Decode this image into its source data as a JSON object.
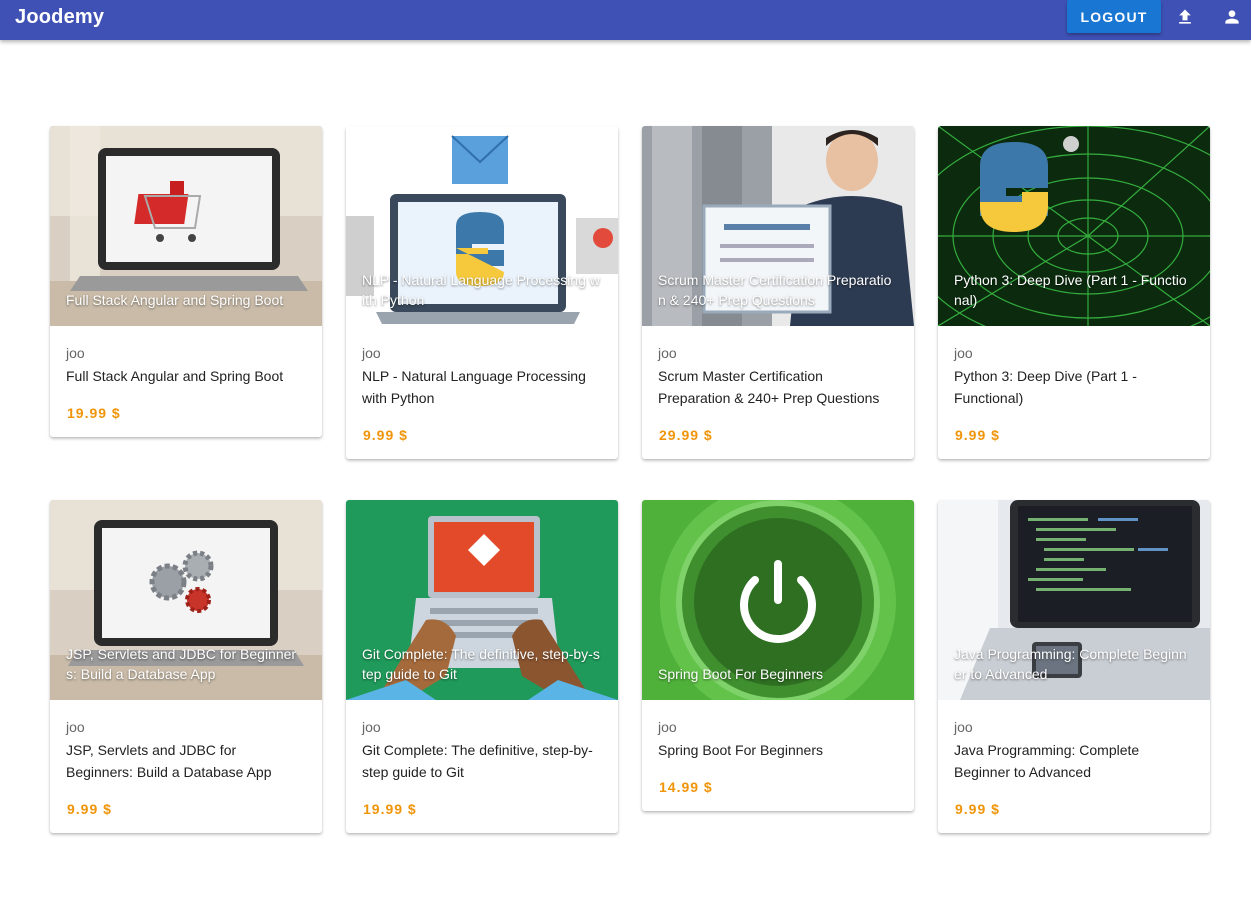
{
  "app": {
    "title": "Joodemy"
  },
  "toolbar": {
    "logout_label": "LOGOUT",
    "upload_icon": "upload-icon",
    "account_icon": "account-icon"
  },
  "colors": {
    "appbar": "#3f51b5",
    "logout_button": "#1976d2",
    "price": "#f0950a"
  },
  "courses": [
    {
      "overlay": "Full Stack Angular and Spring Boot",
      "author": "joo",
      "title": "Full Stack Angular and Spring Boot",
      "price": "19.99 $"
    },
    {
      "overlay": "NLP - Natural Language Processing with Python",
      "author": "joo",
      "title": "NLP - Natural Language Processing with Python",
      "price": "9.99 $"
    },
    {
      "overlay": "Scrum Master Certification Preparation & 240+ Prep Questions",
      "author": "joo",
      "title": "Scrum Master Certification Preparation & 240+ Prep Questions",
      "price": "29.99 $"
    },
    {
      "overlay": "Python 3: Deep Dive (Part 1 - Functional)",
      "author": "joo",
      "title": "Python 3: Deep Dive (Part 1 - Functional)",
      "price": "9.99 $"
    },
    {
      "overlay": "JSP, Servlets and JDBC for Beginners: Build a Database App",
      "author": "joo",
      "title": "JSP, Servlets and JDBC for Beginners: Build a Database App",
      "price": "9.99 $"
    },
    {
      "overlay": "Git Complete: The definitive, step-by-step guide to Git",
      "author": "joo",
      "title": "Git Complete: The definitive, step-by-step guide to Git",
      "price": "19.99 $"
    },
    {
      "overlay": "Spring Boot For Beginners",
      "author": "joo",
      "title": "Spring Boot For Beginners",
      "price": "14.99 $"
    },
    {
      "overlay": "Java Programming: Complete Beginner to Advanced",
      "author": "joo",
      "title": "Java Programming: Complete Beginner to Advanced",
      "price": "9.99 $"
    }
  ]
}
